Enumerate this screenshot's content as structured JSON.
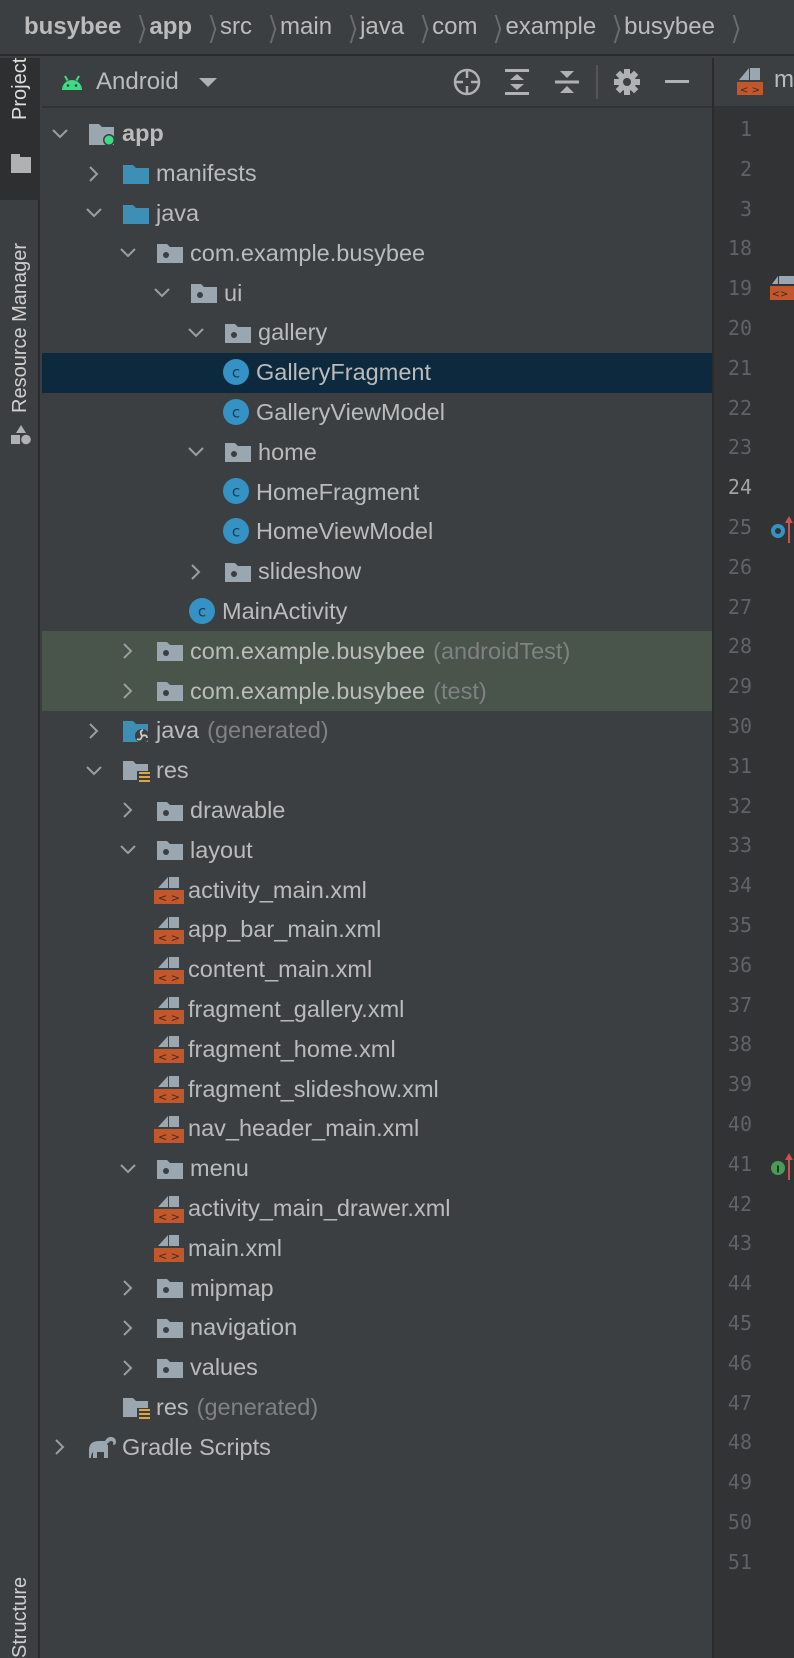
{
  "breadcrumb": [
    {
      "label": "busybee",
      "bold": true
    },
    {
      "label": "app",
      "bold": true
    },
    {
      "label": "src",
      "bold": false
    },
    {
      "label": "main",
      "bold": false
    },
    {
      "label": "java",
      "bold": false
    },
    {
      "label": "com",
      "bold": false
    },
    {
      "label": "example",
      "bold": false
    },
    {
      "label": "busybee",
      "bold": false
    }
  ],
  "toolstrip": {
    "project": "Project",
    "resource_manager": "Resource Manager",
    "structure": "Structure"
  },
  "panel": {
    "title": "Android",
    "icons": [
      "locate-icon",
      "expand-all-icon",
      "collapse-all-icon",
      "gear-icon",
      "hide-icon"
    ]
  },
  "editor_tab": {
    "label": "main.xml",
    "icon": "xml-file-icon"
  },
  "tree": [
    {
      "label": "app",
      "depth": 0,
      "expander": "open",
      "icon": "module-folder",
      "bold": true,
      "state": ""
    },
    {
      "label": "manifests",
      "depth": 1,
      "expander": "closed",
      "icon": "blue-folder",
      "state": ""
    },
    {
      "label": "java",
      "depth": 1,
      "expander": "open",
      "icon": "blue-folder",
      "state": ""
    },
    {
      "label": "com.example.busybee",
      "depth": 2,
      "expander": "open",
      "icon": "package",
      "state": ""
    },
    {
      "label": "ui",
      "depth": 3,
      "expander": "open",
      "icon": "package",
      "state": ""
    },
    {
      "label": "gallery",
      "depth": 4,
      "expander": "open",
      "icon": "package",
      "state": ""
    },
    {
      "label": "GalleryFragment",
      "depth": 5,
      "expander": "",
      "icon": "class",
      "state": "selected"
    },
    {
      "label": "GalleryViewModel",
      "depth": 5,
      "expander": "",
      "icon": "class",
      "state": ""
    },
    {
      "label": "home",
      "depth": 4,
      "expander": "open",
      "icon": "package",
      "state": ""
    },
    {
      "label": "HomeFragment",
      "depth": 5,
      "expander": "",
      "icon": "class",
      "state": ""
    },
    {
      "label": "HomeViewModel",
      "depth": 5,
      "expander": "",
      "icon": "class",
      "state": ""
    },
    {
      "label": "slideshow",
      "depth": 4,
      "expander": "closed",
      "icon": "package",
      "state": ""
    },
    {
      "label": "MainActivity",
      "depth": 4,
      "expander": "",
      "icon": "class",
      "state": ""
    },
    {
      "label": "com.example.busybee",
      "suffix": "(androidTest)",
      "depth": 2,
      "expander": "closed",
      "icon": "package",
      "state": "test"
    },
    {
      "label": "com.example.busybee",
      "suffix": "(test)",
      "depth": 2,
      "expander": "closed",
      "icon": "package",
      "state": "test"
    },
    {
      "label": "java",
      "suffix": "(generated)",
      "depth": 1,
      "expander": "closed",
      "icon": "generated-folder",
      "state": ""
    },
    {
      "label": "res",
      "depth": 1,
      "expander": "open",
      "icon": "res-folder",
      "state": ""
    },
    {
      "label": "drawable",
      "depth": 2,
      "expander": "closed",
      "icon": "package",
      "state": ""
    },
    {
      "label": "layout",
      "depth": 2,
      "expander": "open",
      "icon": "package",
      "state": ""
    },
    {
      "label": "activity_main.xml",
      "depth": 3,
      "expander": "",
      "icon": "xml",
      "state": ""
    },
    {
      "label": "app_bar_main.xml",
      "depth": 3,
      "expander": "",
      "icon": "xml",
      "state": ""
    },
    {
      "label": "content_main.xml",
      "depth": 3,
      "expander": "",
      "icon": "xml",
      "state": ""
    },
    {
      "label": "fragment_gallery.xml",
      "depth": 3,
      "expander": "",
      "icon": "xml",
      "state": ""
    },
    {
      "label": "fragment_home.xml",
      "depth": 3,
      "expander": "",
      "icon": "xml",
      "state": ""
    },
    {
      "label": "fragment_slideshow.xml",
      "depth": 3,
      "expander": "",
      "icon": "xml",
      "state": ""
    },
    {
      "label": "nav_header_main.xml",
      "depth": 3,
      "expander": "",
      "icon": "xml",
      "state": ""
    },
    {
      "label": "menu",
      "depth": 2,
      "expander": "open",
      "icon": "package",
      "state": ""
    },
    {
      "label": "activity_main_drawer.xml",
      "depth": 3,
      "expander": "",
      "icon": "xml",
      "state": ""
    },
    {
      "label": "main.xml",
      "depth": 3,
      "expander": "",
      "icon": "xml",
      "state": ""
    },
    {
      "label": "mipmap",
      "depth": 2,
      "expander": "closed",
      "icon": "package",
      "state": ""
    },
    {
      "label": "navigation",
      "depth": 2,
      "expander": "closed",
      "icon": "package",
      "state": ""
    },
    {
      "label": "values",
      "depth": 2,
      "expander": "closed",
      "icon": "package",
      "state": ""
    },
    {
      "label": "res",
      "suffix": "(generated)",
      "depth": 1,
      "expander": "",
      "icon": "res-folder",
      "state": ""
    },
    {
      "label": "Gradle Scripts",
      "depth": 0,
      "expander": "closed",
      "icon": "gradle",
      "state": ""
    }
  ],
  "gutter": {
    "line_numbers": [
      "1",
      "2",
      "3",
      "18",
      "19",
      "20",
      "21",
      "22",
      "23",
      "24",
      "25",
      "26",
      "27",
      "28",
      "29",
      "30",
      "31",
      "32",
      "33",
      "34",
      "35",
      "36",
      "37",
      "38",
      "39",
      "40",
      "41",
      "42",
      "43",
      "44",
      "45",
      "46",
      "47",
      "48",
      "49",
      "50",
      "51"
    ],
    "current_line": "24",
    "markers": [
      {
        "line": "19",
        "icon": "xml-file-icon"
      },
      {
        "line": "25",
        "icon": "overrides-method-icon"
      },
      {
        "line": "41",
        "icon": "implements-method-icon"
      }
    ]
  },
  "colors": {
    "selection": "#0d293e",
    "test_row": "#49544a",
    "class_icon": "#3592c4",
    "blue_folder": "#3d8fb5",
    "xml_orange": "#c2572b",
    "android_green": "#3ddc84",
    "res_stripes": "#e0a43a"
  }
}
